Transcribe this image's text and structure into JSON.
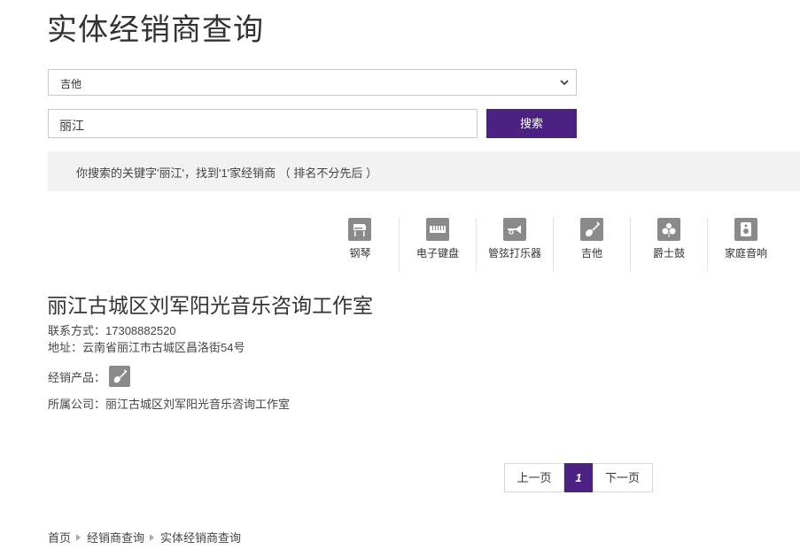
{
  "page": {
    "title": "实体经销商查询"
  },
  "filter": {
    "selected": "吉他"
  },
  "search": {
    "value": "丽江",
    "button": "搜索"
  },
  "result": {
    "summary": "你搜索的关键字'丽江'，找到'1'家经销商 （ 排名不分先后 ）"
  },
  "categories": [
    {
      "label": "钢琴",
      "icon": "piano-icon"
    },
    {
      "label": "电子键盘",
      "icon": "keyboard-icon"
    },
    {
      "label": "管弦打乐器",
      "icon": "trumpet-icon"
    },
    {
      "label": "吉他",
      "icon": "guitar-icon"
    },
    {
      "label": "爵士鼓",
      "icon": "drum-icon"
    },
    {
      "label": "家庭音响",
      "icon": "speaker-icon"
    }
  ],
  "dealer": {
    "name": "丽江古城区刘军阳光音乐咨询工作室",
    "contact": "联系方式：17308882520",
    "address": "地址：云南省丽江市古城区昌洛街54号",
    "products_label": "经销产品：",
    "product_icon": "guitar-icon",
    "company": "所属公司：丽江古城区刘军阳光音乐咨询工作室"
  },
  "pagination": {
    "prev": "上一页",
    "current": "1",
    "next": "下一页"
  },
  "breadcrumb": [
    "首页",
    "经销商查询",
    "实体经销商查询"
  ],
  "colors": {
    "accent": "#4b2181",
    "icon_bg": "#8a8a8a",
    "result_bg": "#f2f2f2"
  }
}
